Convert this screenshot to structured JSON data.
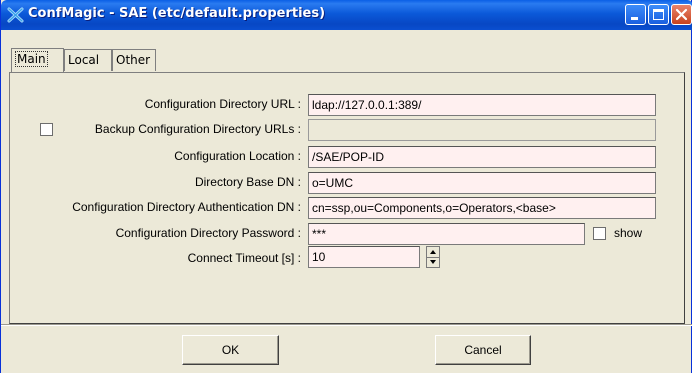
{
  "window": {
    "title": "ConfMagic - SAE (etc/default.properties)"
  },
  "tabs": [
    {
      "label": "Main",
      "active": true
    },
    {
      "label": "Local",
      "active": false
    },
    {
      "label": "Other",
      "active": false
    }
  ],
  "form": {
    "config_dir_url": {
      "label": "Configuration Directory URL :",
      "value": "ldap://127.0.0.1:389/"
    },
    "backup_urls": {
      "label": "Backup Configuration Directory URLs :",
      "value": "",
      "checked": false,
      "enabled": false
    },
    "config_location": {
      "label": "Configuration Location :",
      "value": "/SAE/POP-ID"
    },
    "base_dn": {
      "label": "Directory Base DN :",
      "value": "o=UMC"
    },
    "auth_dn": {
      "label": "Configuration Directory Authentication DN :",
      "value": "cn=ssp,ou=Components,o=Operators,<base>"
    },
    "password": {
      "label": "Configuration Directory Password :",
      "value": "***",
      "show_label": "show",
      "show_checked": false
    },
    "timeout": {
      "label": "Connect Timeout [s] :",
      "value": "10"
    }
  },
  "buttons": {
    "ok": "OK",
    "cancel": "Cancel"
  },
  "colors": {
    "titlebar": "#0b59d9",
    "field_background": "#fff0f0",
    "window_background": "#ece9d8"
  },
  "icons": [
    "confmagic-app-icon",
    "minimize-icon",
    "maximize-icon",
    "close-icon",
    "spinner-up-icon",
    "spinner-down-icon"
  ]
}
